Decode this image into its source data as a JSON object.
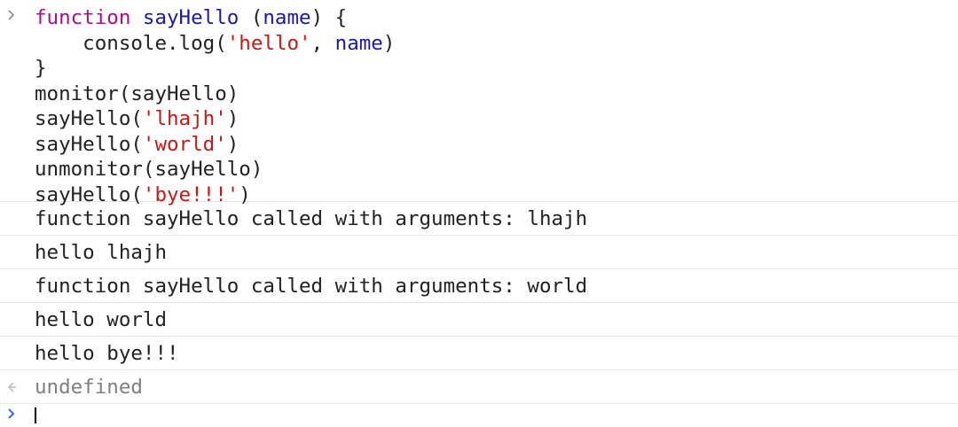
{
  "console": {
    "input_prompt_icon": "chevron-right-icon",
    "input_lines": [
      [
        {
          "t": "function",
          "c": "kw"
        },
        {
          "t": " ",
          "c": "plain"
        },
        {
          "t": "sayHello",
          "c": "fn2"
        },
        {
          "t": " (",
          "c": "plain"
        },
        {
          "t": "name",
          "c": "fn2"
        },
        {
          "t": ") {",
          "c": "plain"
        }
      ],
      [
        {
          "t": "    console.log(",
          "c": "plain"
        },
        {
          "t": "'hello'",
          "c": "str"
        },
        {
          "t": ", ",
          "c": "plain"
        },
        {
          "t": "name",
          "c": "fn2"
        },
        {
          "t": ")",
          "c": "plain"
        }
      ],
      [
        {
          "t": "}",
          "c": "plain"
        }
      ],
      [
        {
          "t": "monitor(sayHello)",
          "c": "plain"
        }
      ],
      [
        {
          "t": "sayHello(",
          "c": "plain"
        },
        {
          "t": "'lhajh'",
          "c": "str"
        },
        {
          "t": ")",
          "c": "plain"
        }
      ],
      [
        {
          "t": "sayHello(",
          "c": "plain"
        },
        {
          "t": "'world'",
          "c": "str"
        },
        {
          "t": ")",
          "c": "plain"
        }
      ],
      [
        {
          "t": "unmonitor(sayHello)",
          "c": "plain"
        }
      ],
      [
        {
          "t": "sayHello(",
          "c": "plain"
        },
        {
          "t": "'bye!!!'",
          "c": "str"
        },
        {
          "t": ")",
          "c": "plain"
        }
      ]
    ],
    "messages": [
      "function sayHello called with arguments: lhajh",
      "hello lhajh",
      "function sayHello called with arguments: world",
      "hello world",
      "hello bye!!!"
    ],
    "result_icon": "return-arrow-icon",
    "result": "undefined",
    "active_prompt_icon": "chevron-right-icon"
  },
  "colors": {
    "keyword": "#aa0d91",
    "identifier": "#1a1aa6",
    "string": "#c41a16",
    "text": "#222222",
    "result": "#808080",
    "separator": "#e6e6e6",
    "active_prompt": "#2a6ef5"
  }
}
